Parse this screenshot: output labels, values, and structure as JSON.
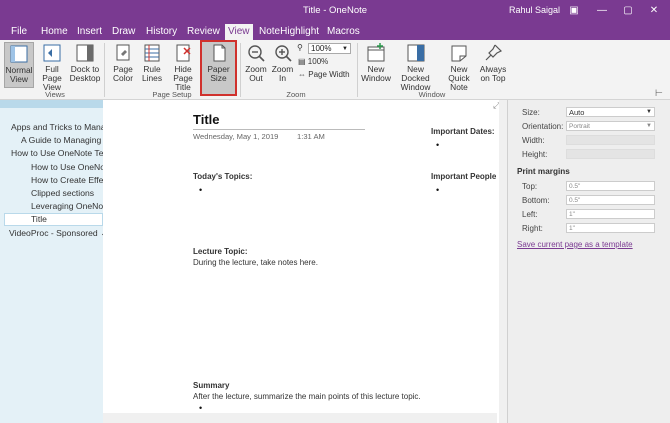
{
  "window": {
    "title": "Title - OneNote",
    "user": "Rahul Saigal"
  },
  "tabs": [
    "File",
    "Home",
    "Insert",
    "Draw",
    "History",
    "Review",
    "View",
    "NoteHighlight",
    "Macros"
  ],
  "ribbon": {
    "views": {
      "label": "Views",
      "normal": "Normal\nView",
      "fullpage": "Full Page\nView",
      "dock": "Dock to\nDesktop"
    },
    "pagesetup": {
      "label": "Page Setup",
      "pagecolor": "Page\nColor",
      "rulelines": "Rule\nLines",
      "hidetitle": "Hide\nPage Title",
      "papersize": "Paper\nSize"
    },
    "zoom": {
      "label": "Zoom",
      "zoomout": "Zoom\nOut",
      "zoomin": "Zoom\nIn",
      "value": "100%",
      "hundred": "100%",
      "pagewidth": "Page Width"
    },
    "window": {
      "label": "Window",
      "newwindow": "New\nWindow",
      "newdocked": "New Docked\nWindow",
      "quicknote": "New Quick\nNote",
      "ontop": "Always\non Top"
    }
  },
  "sidebar": {
    "pages": [
      "Apps and Tricks to Mana",
      "A Guide to Managing",
      "How to Use OneNote Te",
      "How to Use OneNo",
      "How to Create Effe",
      "Clipped sections",
      "Leveraging OneNot",
      "Title"
    ],
    "section": "VideoProc - Sponsored"
  },
  "page": {
    "title": "Title",
    "date": "Wednesday, May 1, 2019",
    "time": "1:31 AM",
    "important_dates": "Important Dates:",
    "important_people": "Important People",
    "todays_topics": "Today's Topics:",
    "lecture_topic": "Lecture Topic:",
    "lecture_text": "During the lecture, take notes here.",
    "summary": "Summary",
    "summary_text": "After the lecture, summarize the main points of this lecture topic.",
    "bullet": "•"
  },
  "paper": {
    "size_label": "Size:",
    "size_value": "Auto",
    "orientation_label": "Orientation:",
    "orientation_value": "Portrait",
    "width_label": "Width:",
    "height_label": "Height:",
    "margins_title": "Print margins",
    "top_label": "Top:",
    "top_value": "0.5\"",
    "bottom_label": "Bottom:",
    "bottom_value": "0.5\"",
    "left_label": "Left:",
    "left_value": "1\"",
    "right_label": "Right:",
    "right_value": "1\"",
    "save_link": "Save current page as a template"
  }
}
